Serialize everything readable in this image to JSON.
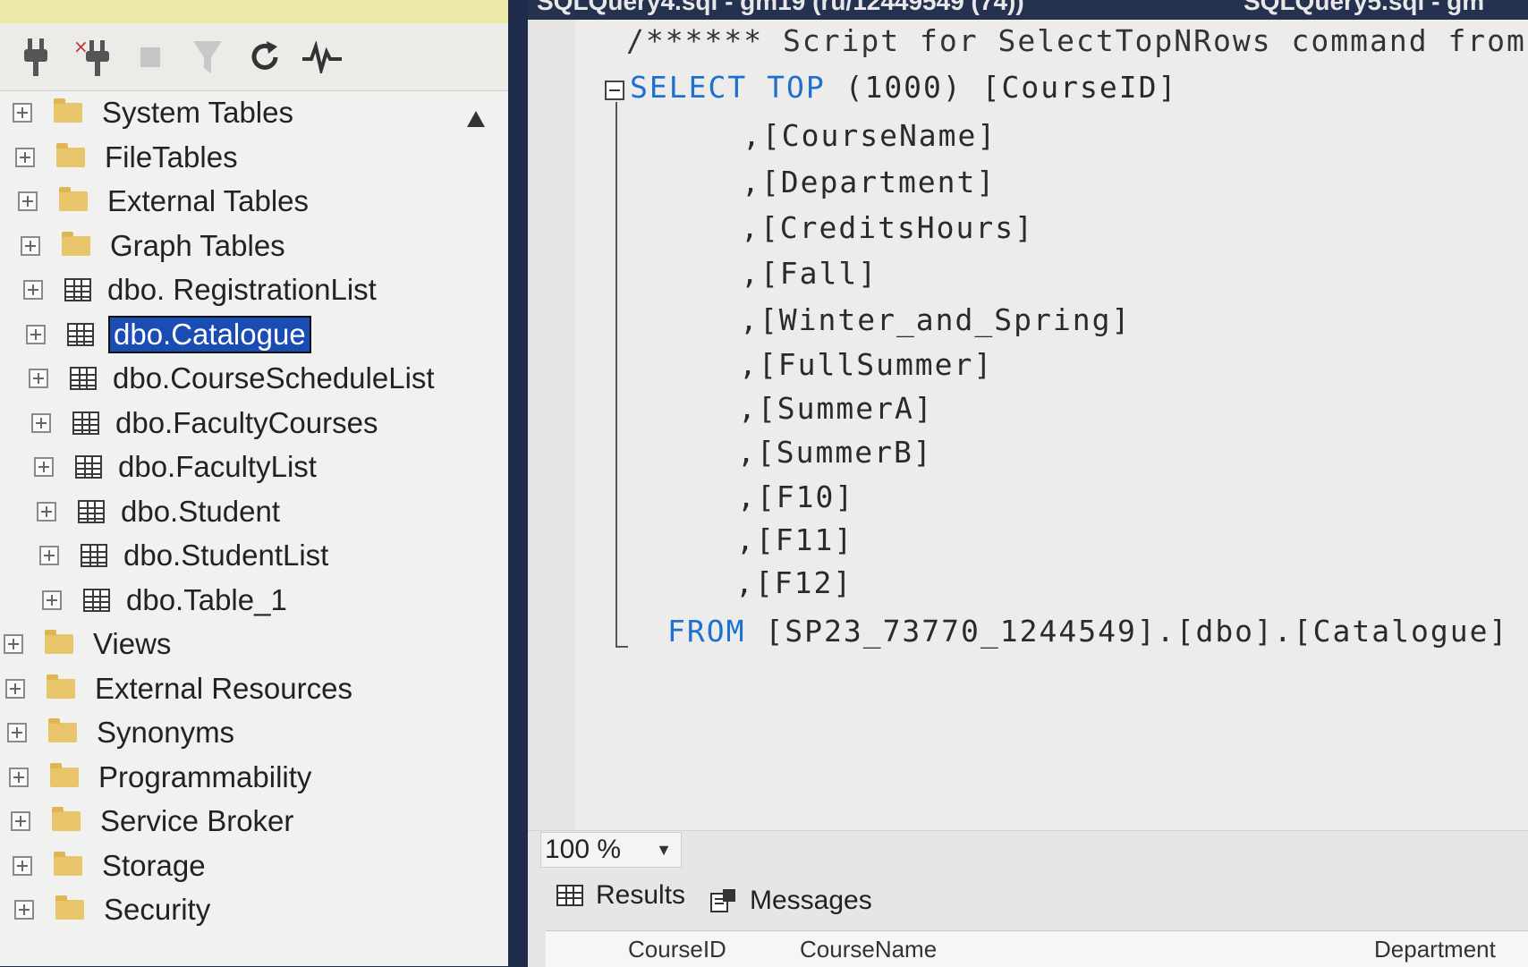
{
  "tab_bar": {
    "items": [
      "SQLQuery4.sql - gm19 (ru/12449549 (74))",
      "SQLQuery5.sql - gm"
    ]
  },
  "toolbar": {
    "icons": [
      "connect-icon",
      "disconnect-icon",
      "stop-icon",
      "filter-icon",
      "refresh-icon",
      "activity-monitor-icon"
    ]
  },
  "tree": {
    "items": [
      {
        "label": "System Tables",
        "kind": "folder"
      },
      {
        "label": "FileTables",
        "kind": "folder"
      },
      {
        "label": "External Tables",
        "kind": "folder"
      },
      {
        "label": "Graph Tables",
        "kind": "folder"
      },
      {
        "label": "dbo. RegistrationList",
        "kind": "table"
      },
      {
        "label": "dbo.Catalogue",
        "kind": "table",
        "selected": true
      },
      {
        "label": "dbo.CourseScheduleList",
        "kind": "table"
      },
      {
        "label": "dbo.FacultyCourses",
        "kind": "table"
      },
      {
        "label": "dbo.FacultyList",
        "kind": "table"
      },
      {
        "label": "dbo.Student",
        "kind": "table"
      },
      {
        "label": "dbo.StudentList",
        "kind": "table"
      },
      {
        "label": "dbo.Table_1",
        "kind": "table"
      },
      {
        "label": "Views",
        "kind": "folder"
      },
      {
        "label": "External Resources",
        "kind": "folder"
      },
      {
        "label": "Synonyms",
        "kind": "folder"
      },
      {
        "label": "Programmability",
        "kind": "folder"
      },
      {
        "label": "Service Broker",
        "kind": "folder"
      },
      {
        "label": "Storage",
        "kind": "folder"
      },
      {
        "label": "Security",
        "kind": "folder"
      }
    ]
  },
  "editor": {
    "comment": "/****** Script for SelectTopNRows command from",
    "select_kw": "SELECT",
    "top_kw": "TOP",
    "select_rest": "(1000) [CourseID]",
    "columns": [
      ",[CourseName]",
      ",[Department]",
      ",[CreditsHours]",
      ",[Fall]",
      ",[Winter_and_Spring]",
      ",[FullSummer]",
      ",[SummerA]",
      ",[SummerB]",
      ",[F10]",
      ",[F11]",
      ",[F12]"
    ],
    "from_kw": "FROM",
    "from_rest": "[SP23_73770_1244549].[dbo].[Catalogue]"
  },
  "zoom": {
    "value": "100 %"
  },
  "results_tabs": {
    "results": "Results",
    "messages": "Messages"
  },
  "grid": {
    "headers": [
      "CourseID",
      "CourseName",
      "Department"
    ]
  },
  "colors": {
    "selection": "#1a4db3",
    "keyword": "#1d6fd1",
    "folder": "#e8c46a"
  }
}
